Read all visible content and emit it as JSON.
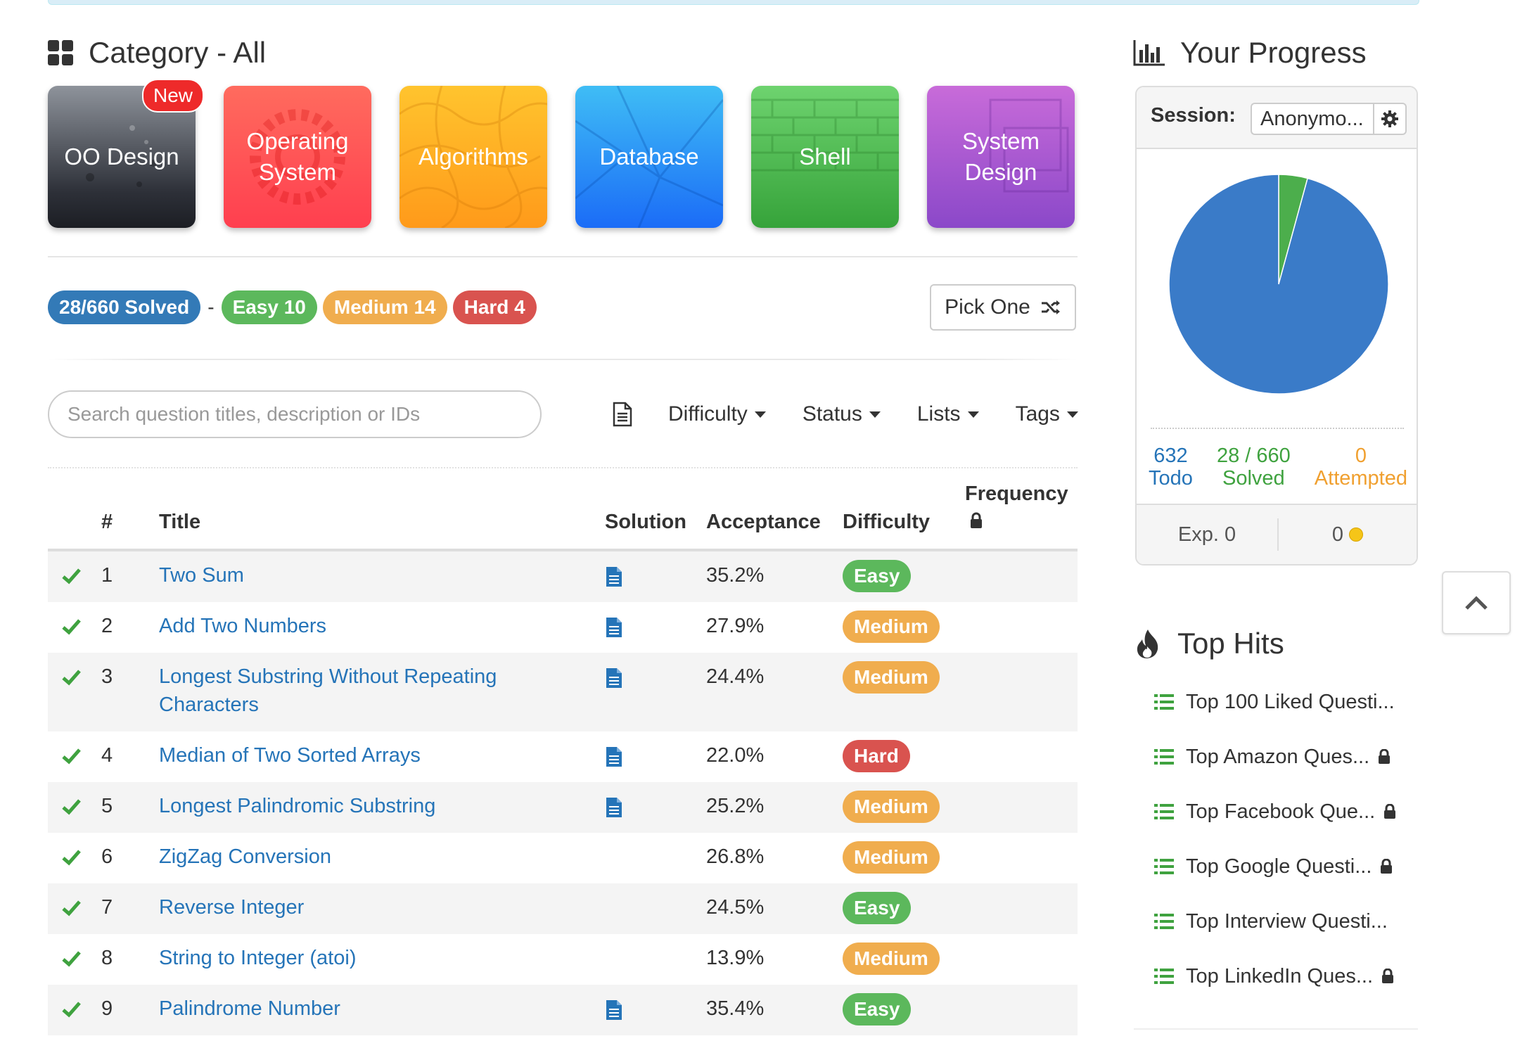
{
  "category": {
    "title": "Category - All",
    "cards": [
      {
        "label": "OO Design",
        "badge": "New"
      },
      {
        "label": "Operating System"
      },
      {
        "label": "Algorithms"
      },
      {
        "label": "Database"
      },
      {
        "label": "Shell"
      },
      {
        "label": "System Design"
      }
    ]
  },
  "summary": {
    "solved": "28/660 Solved",
    "separator": "-",
    "easy": "Easy 10",
    "medium": "Medium 14",
    "hard": "Hard 4",
    "pick_one": "Pick One"
  },
  "search": {
    "placeholder": "Search question titles, description or IDs",
    "value": ""
  },
  "filters": {
    "difficulty": "Difficulty",
    "status": "Status",
    "lists": "Lists",
    "tags": "Tags"
  },
  "table": {
    "headers": {
      "num": "#",
      "title": "Title",
      "solution": "Solution",
      "acceptance": "Acceptance",
      "difficulty": "Difficulty",
      "frequency": "Frequency"
    },
    "rows": [
      {
        "num": "1",
        "title": "Two Sum",
        "solution": true,
        "acceptance": "35.2%",
        "difficulty": "Easy"
      },
      {
        "num": "2",
        "title": "Add Two Numbers",
        "solution": true,
        "acceptance": "27.9%",
        "difficulty": "Medium"
      },
      {
        "num": "3",
        "title": "Longest Substring Without Repeating Characters",
        "solution": true,
        "acceptance": "24.4%",
        "difficulty": "Medium"
      },
      {
        "num": "4",
        "title": "Median of Two Sorted Arrays",
        "solution": true,
        "acceptance": "22.0%",
        "difficulty": "Hard"
      },
      {
        "num": "5",
        "title": "Longest Palindromic Substring",
        "solution": true,
        "acceptance": "25.2%",
        "difficulty": "Medium"
      },
      {
        "num": "6",
        "title": "ZigZag Conversion",
        "solution": false,
        "acceptance": "26.8%",
        "difficulty": "Medium"
      },
      {
        "num": "7",
        "title": "Reverse Integer",
        "solution": false,
        "acceptance": "24.5%",
        "difficulty": "Easy"
      },
      {
        "num": "8",
        "title": "String to Integer (atoi)",
        "solution": false,
        "acceptance": "13.9%",
        "difficulty": "Medium"
      },
      {
        "num": "9",
        "title": "Palindrome Number",
        "solution": true,
        "acceptance": "35.4%",
        "difficulty": "Easy"
      }
    ]
  },
  "progress": {
    "title": "Your Progress",
    "session_label": "Session:",
    "session_value": "Anonymo...",
    "todo_count": "632",
    "todo_label": "Todo",
    "solved_count": "28 / 660",
    "solved_label": "Solved",
    "attempted_count": "0",
    "attempted_label": "Attempted",
    "exp": "Exp. 0",
    "coins": "0",
    "pie": {
      "todo": 632,
      "solved": 28,
      "attempted": 0
    }
  },
  "top_hits": {
    "title": "Top Hits",
    "items": [
      {
        "label": "Top 100 Liked Questi...",
        "locked": false
      },
      {
        "label": "Top Amazon Ques...",
        "locked": true
      },
      {
        "label": "Top Facebook Que...",
        "locked": true
      },
      {
        "label": "Top Google Questi...",
        "locked": true
      },
      {
        "label": "Top Interview Questi...",
        "locked": false
      },
      {
        "label": "Top LinkedIn Ques...",
        "locked": true
      }
    ]
  },
  "colors": {
    "link": "#2574b8",
    "easy": "#5cb85c",
    "medium": "#f0ad4e",
    "hard": "#d9534f",
    "solved_blue": "#337ab7",
    "pie_todo": "#3a7bc8",
    "pie_solved": "#4cae4c"
  },
  "icons": [
    "grid-icon",
    "shuffle-icon",
    "document-icon",
    "caret-down-icon",
    "lock-icon",
    "check-icon",
    "bar-chart-icon",
    "gear-icon",
    "coin-icon",
    "chevron-up-icon",
    "fire-icon",
    "list-icon"
  ]
}
